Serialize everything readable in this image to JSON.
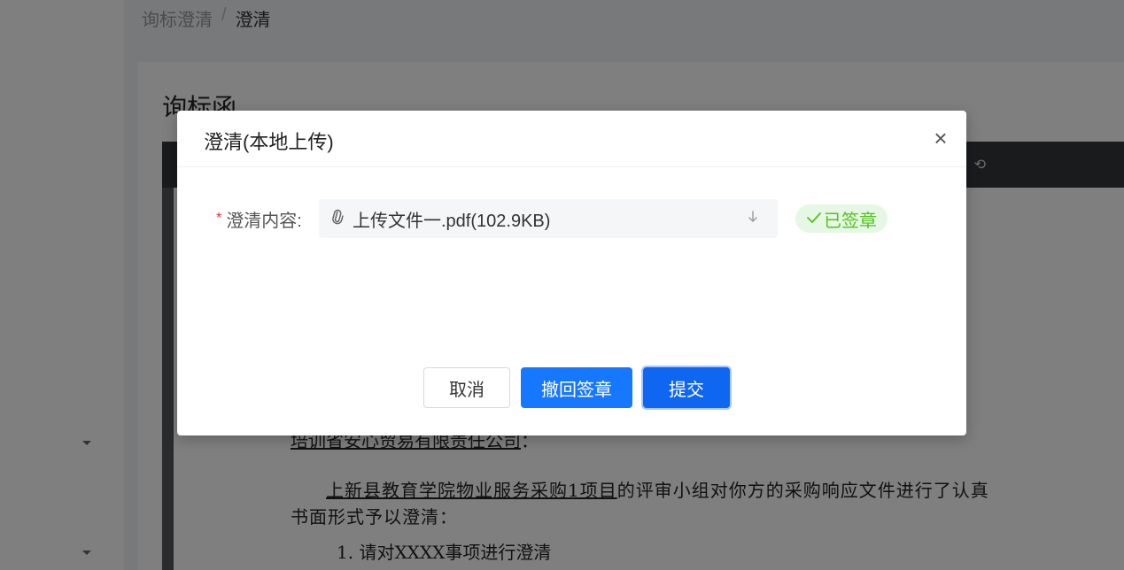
{
  "breadcrumb": {
    "parent": "询标澄清",
    "separator": "/",
    "current": "澄清"
  },
  "page": {
    "title": "询标函"
  },
  "document": {
    "addressee": "培训省安心贸易有限责任公司",
    "addressee_suffix": "：",
    "para_project": "上新县教育学院物业服务采购1项目",
    "para_rest": "的评审小组对你方的采购响应文件进行了认真",
    "para_line2": "书面形式予以澄清：",
    "item1": "1. 请对XXXX事项进行澄清"
  },
  "dialog": {
    "title": "澄清(本地上传)",
    "close_symbol": "×",
    "field_label": "澄清内容:",
    "required_mark": "*",
    "file_name": "上传文件一.pdf(102.9KB)",
    "signed_label": "已签章",
    "buttons": {
      "cancel": "取消",
      "recall": "撤回签章",
      "submit": "提交"
    }
  },
  "colors": {
    "primary": "#1677ff",
    "success": "#52c41a",
    "required": "#f5222d"
  },
  "icons": {
    "attachment": "paperclip-icon",
    "download": "download-icon",
    "signed": "check-icon",
    "close": "close-icon"
  }
}
